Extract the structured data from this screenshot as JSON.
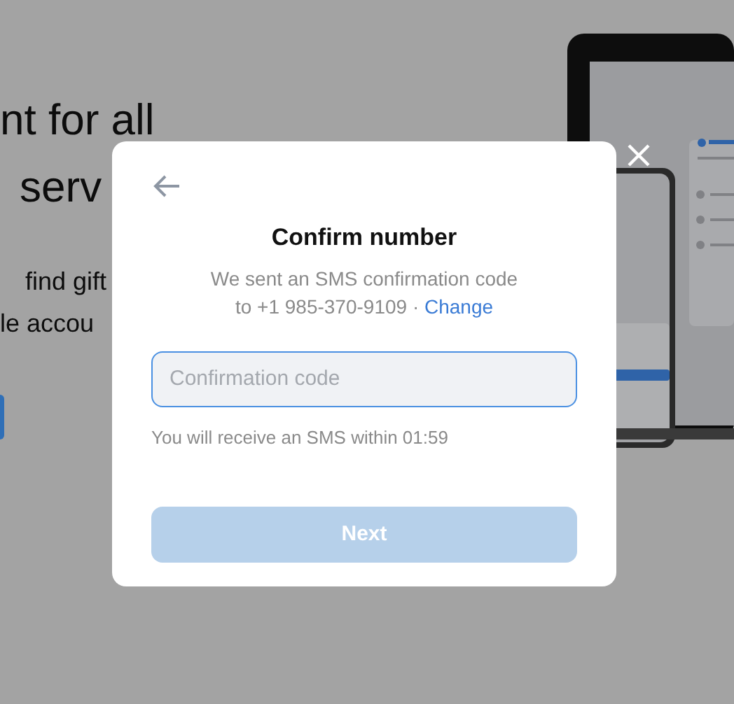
{
  "background": {
    "headline": [
      "nt for all",
      "serv"
    ],
    "text": [
      "find gift",
      "le accou"
    ]
  },
  "dialog": {
    "title": "Confirm number",
    "message": [
      "We sent an SMS confirmation code",
      "to +1 985-370-9109 ·"
    ],
    "change_link": "Change",
    "code_field": {
      "placeholder": "Confirmation code"
    },
    "hint": "You will receive an SMS within 01:59",
    "next_button": {
      "label": "Next",
      "disabled": true
    }
  }
}
